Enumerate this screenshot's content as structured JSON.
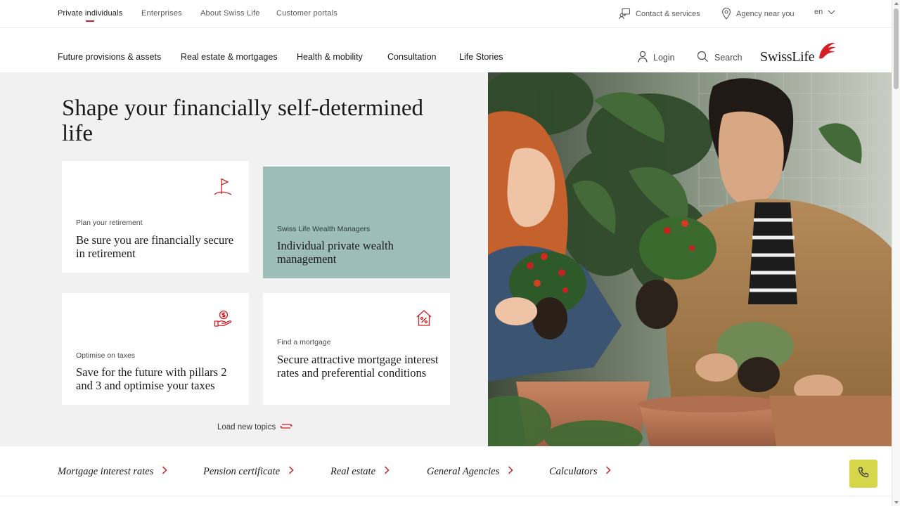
{
  "topbar": {
    "segments": [
      "Private individuals",
      "Enterprises",
      "About Swiss Life",
      "Customer portals"
    ],
    "contact_label": "Contact & services",
    "agency_label": "Agency near you",
    "language": "en"
  },
  "mainnav": {
    "items": [
      "Future provisions & assets",
      "Real estate & mortgages",
      "Health & mobility",
      "Consultation",
      "Life Stories"
    ],
    "login_label": "Login",
    "search_label": "Search",
    "logo_text": "SwissLife"
  },
  "hero": {
    "title": "Shape your financially self-determined life",
    "cards": [
      {
        "eyebrow": "Plan your retirement",
        "headline": "Be sure you are financially secure in retirement",
        "icon": "flag-icon"
      },
      {
        "eyebrow": "Swiss Life Wealth Managers",
        "headline": "Individual private wealth management",
        "icon": ""
      },
      {
        "eyebrow": "Optimise on taxes",
        "headline": "Save for the future with pillars 2 and 3 and optimise your taxes",
        "icon": "money-hand-icon"
      },
      {
        "eyebrow": "Find a mortgage",
        "headline": "Secure attractive mortgage interest rates and preferential conditions",
        "icon": "house-percent-icon"
      }
    ],
    "load_more_label": "Load new topics"
  },
  "quicklinks": [
    "Mortgage interest rates",
    "Pension certificate",
    "Real estate",
    "General Agencies",
    "Calculators"
  ],
  "colors": {
    "brand_red": "#d31f26",
    "teal_card": "#9dbdb9",
    "call_button": "#d6d64a",
    "hero_bg": "#f1f1f1"
  }
}
